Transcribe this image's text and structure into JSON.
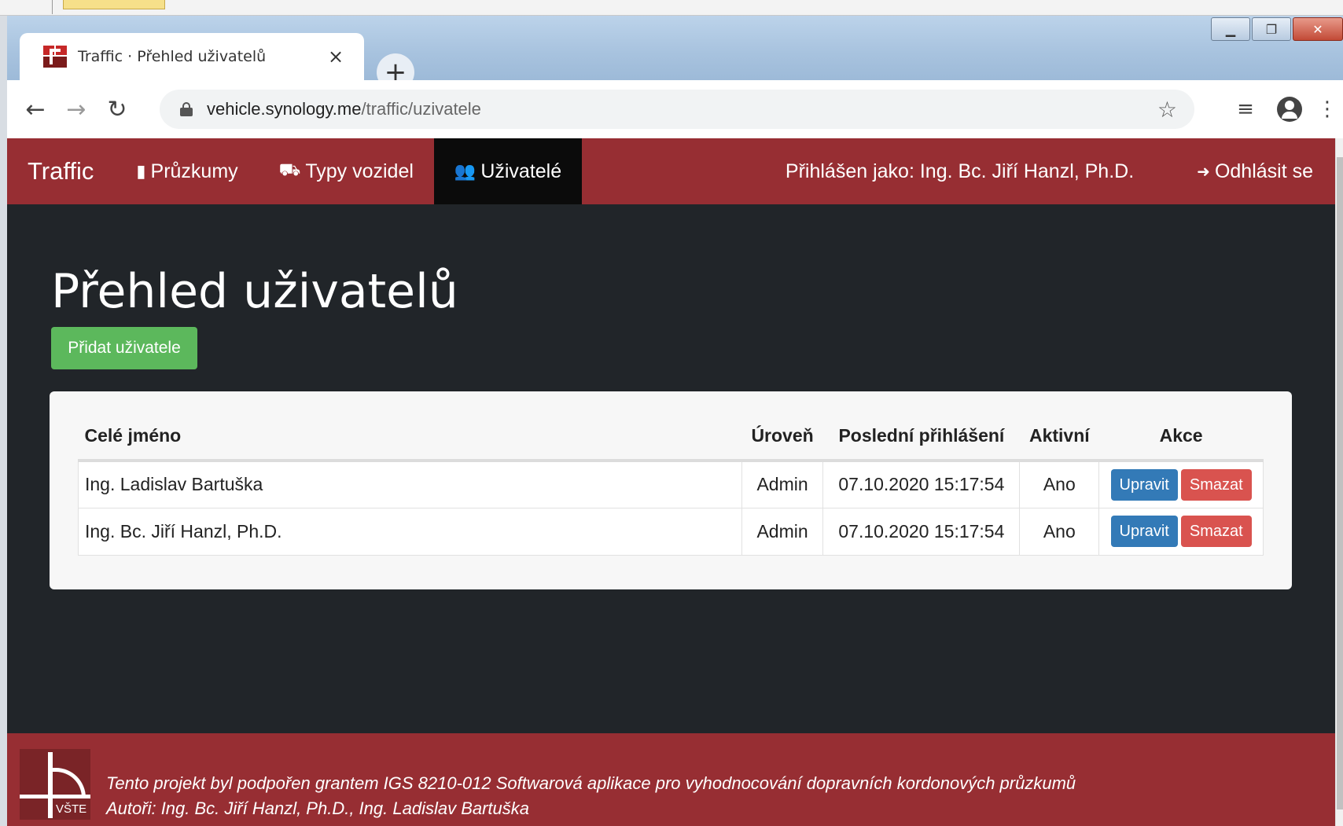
{
  "browser": {
    "tab_title": "Traffic · Přehled uživatelů",
    "tab_close": "×",
    "new_tab": "+",
    "url_host": "vehicle.synology.me",
    "url_path": "/traffic/uzivatele"
  },
  "navbar": {
    "brand": "Traffic",
    "items": [
      {
        "label": "Průzkumy",
        "icon": "clipboard-icon"
      },
      {
        "label": "Typy vozidel",
        "icon": "car-icon"
      },
      {
        "label": "Uživatelé",
        "icon": "users-icon",
        "active": true
      }
    ],
    "logged_in": "Přihlášen jako: Ing. Bc. Jiří Hanzl, Ph.D.",
    "logout": "Odhlásit se"
  },
  "main": {
    "title": "Přehled uživatelů",
    "add_button": "Přidat uživatele",
    "table": {
      "headers": [
        "Celé jméno",
        "Úroveň",
        "Poslední přihlášení",
        "Aktivní",
        "Akce"
      ],
      "rows": [
        {
          "name": "Ing. Ladislav Bartuška",
          "level": "Admin",
          "last_login": "07.10.2020 15:17:54",
          "active": "Ano"
        },
        {
          "name": "Ing. Bc. Jiří Hanzl, Ph.D.",
          "level": "Admin",
          "last_login": "07.10.2020 15:17:54",
          "active": "Ano"
        }
      ],
      "edit_label": "Upravit",
      "delete_label": "Smazat"
    }
  },
  "footer": {
    "logo_text": "VŠTE",
    "line1": "Tento projekt byl podpořen grantem IGS 8210-012 Softwarová aplikace pro vyhodnocování dopravních kordonových průzkumů",
    "line2": "Autoři: Ing. Bc. Jiří Hanzl, Ph.D., Ing. Ladislav Bartuška"
  },
  "colors": {
    "navbar": "#972e33",
    "page_bg": "#212529",
    "success": "#5cb85c",
    "primary": "#337ab7",
    "danger": "#d9534f"
  }
}
